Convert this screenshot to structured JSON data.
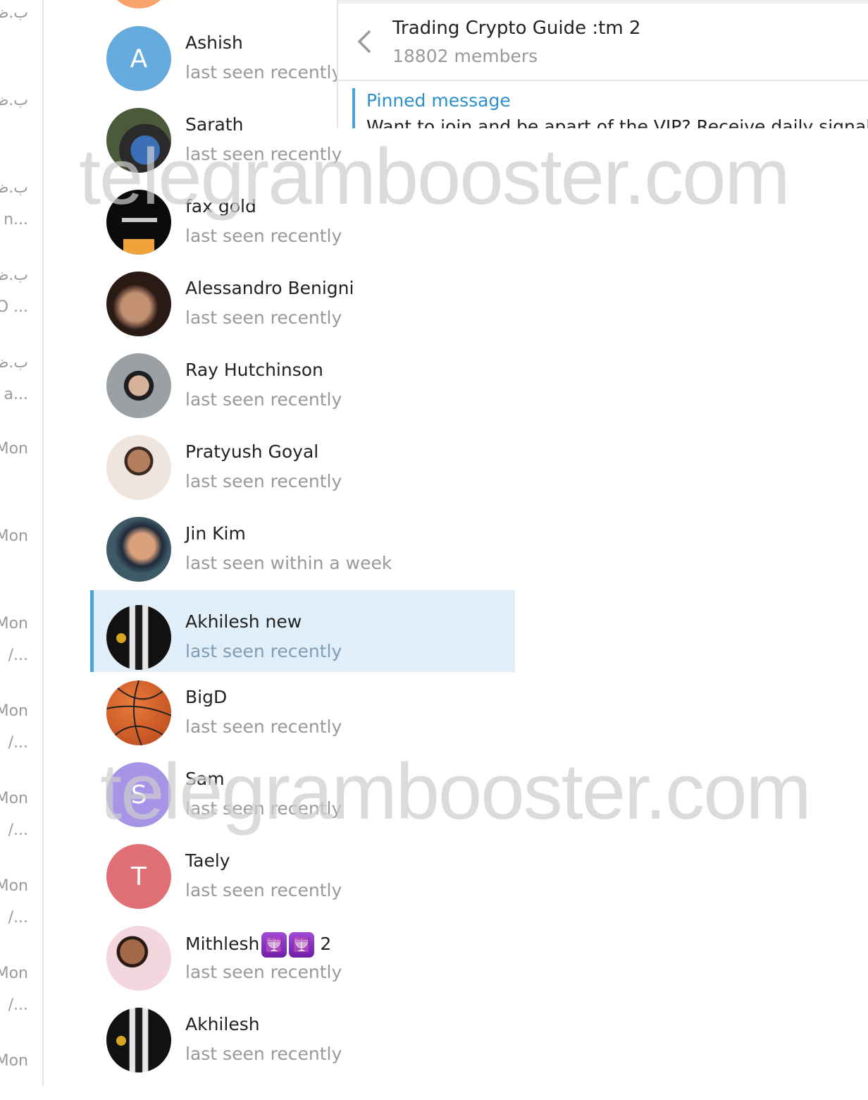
{
  "left_list": {
    "items": [
      {
        "time": "ب.ظ",
        "preview": ""
      },
      {
        "time": "ب.ظ",
        "preview": ""
      },
      {
        "time": "ب.ظ",
        "preview": "n..."
      },
      {
        "time": "ب.ظ",
        "preview": "O ..."
      },
      {
        "time": "ب.ظ",
        "preview": "a..."
      },
      {
        "time": "Mon",
        "preview": ""
      },
      {
        "time": "Mon",
        "preview": ""
      },
      {
        "time": "Mon",
        "preview": "/..."
      },
      {
        "time": "Mon",
        "preview": "/..."
      },
      {
        "time": "Mon",
        "preview": "/..."
      },
      {
        "time": "Mon",
        "preview": "/..."
      },
      {
        "time": "Mon",
        "preview": "/..."
      },
      {
        "time": "Mon",
        "preview": ""
      }
    ]
  },
  "chat": {
    "title": "Trading Crypto Guide :tm 2",
    "subtitle": "18802 members",
    "back_icon": "chevron-left-icon",
    "pinned_label": "Pinned message",
    "pinned_text": "Want to join and be apart of the VIP? Receive daily signals a"
  },
  "members": [
    {
      "name": "Ashish",
      "status": "last seen recently",
      "initial": "A",
      "avatar_color": "#65aadd",
      "avatar": "letter"
    },
    {
      "name": "Sarath",
      "status": "last seen recently",
      "avatar": "photo-cricket"
    },
    {
      "name": "fax gold",
      "status": "last seen recently",
      "avatar": "photo-screenshot"
    },
    {
      "name": "Alessandro Benigni",
      "status": "last seen recently",
      "avatar": "photo-man"
    },
    {
      "name": "Ray Hutchinson",
      "status": "last seen recently",
      "avatar": "photo-man-glasses"
    },
    {
      "name": "Pratyush Goyal",
      "status": "last seen recently",
      "avatar": "photo-man"
    },
    {
      "name": "Jin Kim",
      "status": "last seen within a week",
      "avatar": "photo-man-suit"
    },
    {
      "name": "Akhilesh new",
      "status": "last seen recently",
      "avatar": "photo-suit-bitcoin",
      "selected": true
    },
    {
      "name": "BigD",
      "status": "last seen recently",
      "avatar": "photo-basketball"
    },
    {
      "name": "Sam",
      "status": "last seen recently",
      "initial": "S",
      "avatar_color": "#a695e7",
      "avatar": "letter"
    },
    {
      "name": "Taely",
      "status": "last seen recently",
      "initial": "T",
      "avatar_color": "#e17076",
      "avatar": "letter"
    },
    {
      "name": "Mithlesh",
      "name_suffix": "2",
      "emoji": [
        "🕎",
        "🕎"
      ],
      "status": "last seen recently",
      "avatar": "photo-man"
    },
    {
      "name": "Akhilesh",
      "status": "last seen recently",
      "avatar": "photo-suit-bitcoin"
    }
  ],
  "watermark": "telegrambooster.com",
  "colors": {
    "accent": "#4da2d9",
    "selected_bg": "#e1effa",
    "pinned_label": "#2d8fcd",
    "muted_text": "#999999"
  }
}
